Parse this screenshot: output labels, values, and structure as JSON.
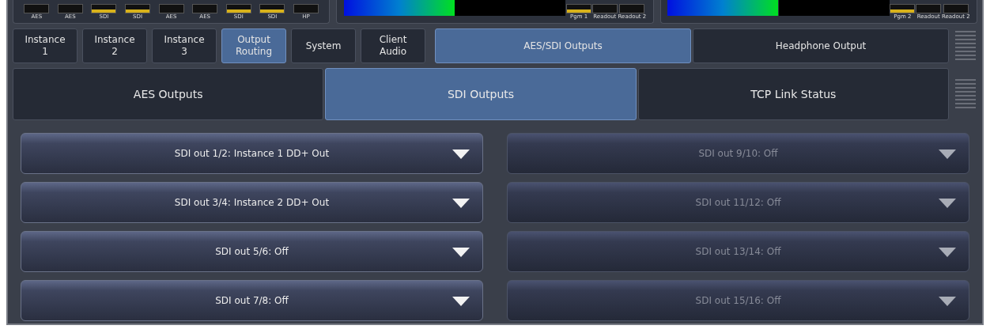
{
  "meter_panels": [
    {
      "kind": "channels",
      "labels": [
        "AES",
        "AES",
        "SDI",
        "SDI",
        "AES",
        "AES",
        "SDI",
        "SDI",
        "HP"
      ]
    },
    {
      "kind": "display",
      "labels": [
        "Pgm 1",
        "Readout",
        "Readout 2"
      ]
    },
    {
      "kind": "display",
      "labels": [
        "Pgm 2",
        "Readout",
        "Readout 2"
      ]
    }
  ],
  "main_tabs": [
    {
      "label": "Instance\n1",
      "selected": false
    },
    {
      "label": "Instance\n2",
      "selected": false
    },
    {
      "label": "Instance\n3",
      "selected": false
    },
    {
      "label": "Output\nRouting",
      "selected": true
    },
    {
      "label": "System",
      "selected": false
    },
    {
      "label": "Client\nAudio",
      "selected": false
    }
  ],
  "output_tabs": [
    {
      "label": "AES/SDI Outputs",
      "selected": true
    },
    {
      "label": "Headphone Output",
      "selected": false
    }
  ],
  "sub_tabs": [
    {
      "label": "AES Outputs",
      "selected": false
    },
    {
      "label": "SDI Outputs",
      "selected": true
    },
    {
      "label": "TCP Link Status",
      "selected": false
    }
  ],
  "dropdowns": [
    {
      "value": "SDI out 1/2: Instance 1 DD+ Out",
      "disabled": false
    },
    {
      "value": "SDI out 3/4: Instance 2 DD+ Out",
      "disabled": false
    },
    {
      "value": "SDI out 5/6: Off",
      "disabled": false
    },
    {
      "value": "SDI out 7/8: Off",
      "disabled": false
    },
    {
      "value": "SDI out 9/10: Off",
      "disabled": true
    },
    {
      "value": "SDI out 11/12: Off",
      "disabled": true
    },
    {
      "value": "SDI out 13/14: Off",
      "disabled": true
    },
    {
      "value": "SDI out 15/16: Off",
      "disabled": true
    }
  ]
}
